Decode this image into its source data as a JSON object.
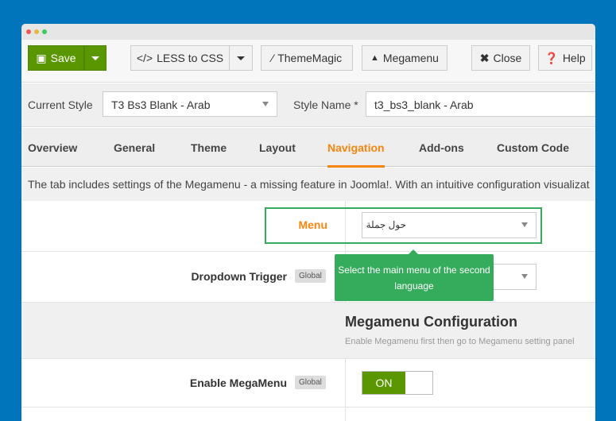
{
  "toolbar": {
    "save": "Save",
    "less": "LESS to CSS",
    "thememagic": "ThemeMagic",
    "megamenu": "Megamenu",
    "close": "Close",
    "help": "Help"
  },
  "style": {
    "current_label": "Current Style",
    "current_value": "T3 Bs3 Blank - Arab",
    "name_label": "Style Name *",
    "name_value": "t3_bs3_blank - Arab"
  },
  "tabs": [
    "Overview",
    "General",
    "Theme",
    "Layout",
    "Navigation",
    "Add-ons",
    "Custom Code"
  ],
  "active_tab": "Navigation",
  "description": "The tab includes settings of the Megamenu - a missing feature in Joomla!. With an intuitive configuration visualizat",
  "fields": {
    "menu": {
      "label": "Menu",
      "value": "حول جملة"
    },
    "dropdown_trigger": {
      "label": "Dropdown Trigger",
      "badge": "Global"
    },
    "enable_megamenu": {
      "label": "Enable MegaMenu",
      "badge": "Global",
      "toggle": "ON"
    }
  },
  "section": {
    "title": "Megamenu Configuration",
    "subtitle": "Enable Megamenu first then go to Megamenu setting panel"
  },
  "tooltip": "Select the main menu of the second language",
  "colors": {
    "accent": "#f7850f",
    "save": "#5a9600",
    "tooltip": "#35ac5c",
    "background": "#0075bb"
  }
}
